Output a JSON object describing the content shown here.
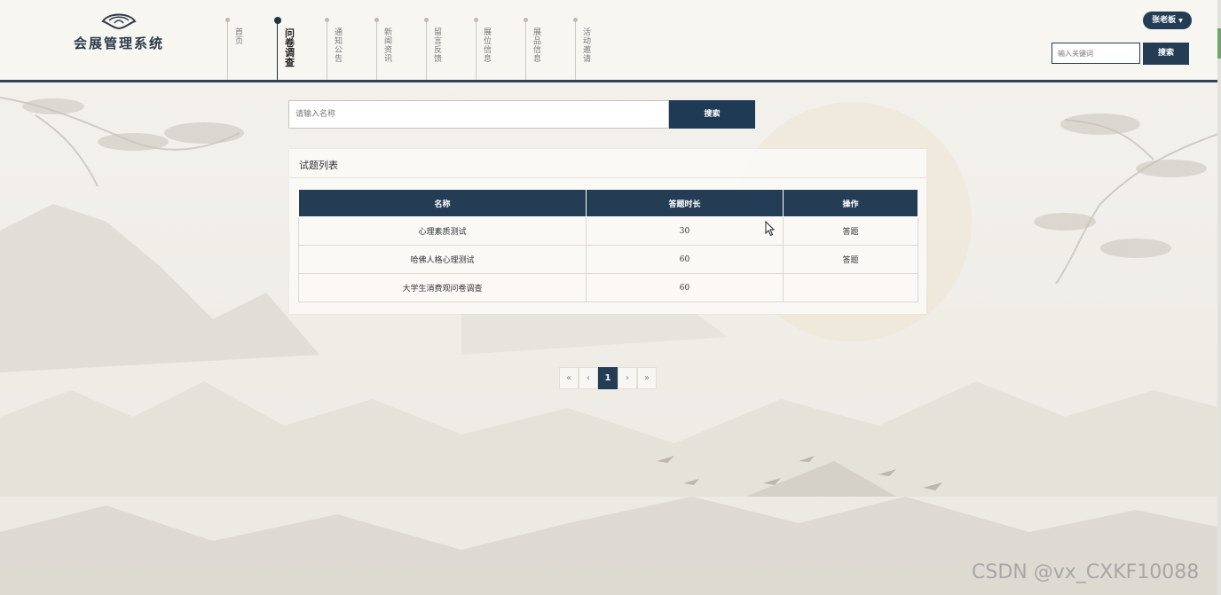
{
  "app": {
    "title": "会展管理系统"
  },
  "nav": {
    "items": [
      {
        "label": "首页",
        "active": false
      },
      {
        "label": "问卷调查",
        "active": true
      },
      {
        "label": "通知公告",
        "active": false
      },
      {
        "label": "新闻资讯",
        "active": false
      },
      {
        "label": "留言反馈",
        "active": false
      },
      {
        "label": "展位信息",
        "active": false
      },
      {
        "label": "展品信息",
        "active": false
      },
      {
        "label": "活动邀请",
        "active": false
      }
    ]
  },
  "user": {
    "name": "张老板",
    "caret": "▼"
  },
  "header_search": {
    "placeholder": "输入关键词",
    "button": "搜索"
  },
  "main_search": {
    "placeholder": "请输入名称",
    "button": "搜索"
  },
  "panel": {
    "title": "试题列表",
    "columns": [
      "名称",
      "答题时长",
      "操作"
    ],
    "rows": [
      {
        "name": "心理素质测试",
        "duration": "30",
        "action": "答题"
      },
      {
        "name": "哈佛人格心理测试",
        "duration": "60",
        "action": "答题"
      },
      {
        "name": "大学生消费观问卷调查",
        "duration": "60",
        "action": ""
      }
    ]
  },
  "pagination": {
    "first": "«",
    "prev": "‹",
    "current": "1",
    "next": "›",
    "last": "»"
  },
  "watermark": "CSDN @vx_CXKF10088",
  "colors": {
    "primary": "#243d55",
    "background": "#f2f0ea"
  }
}
